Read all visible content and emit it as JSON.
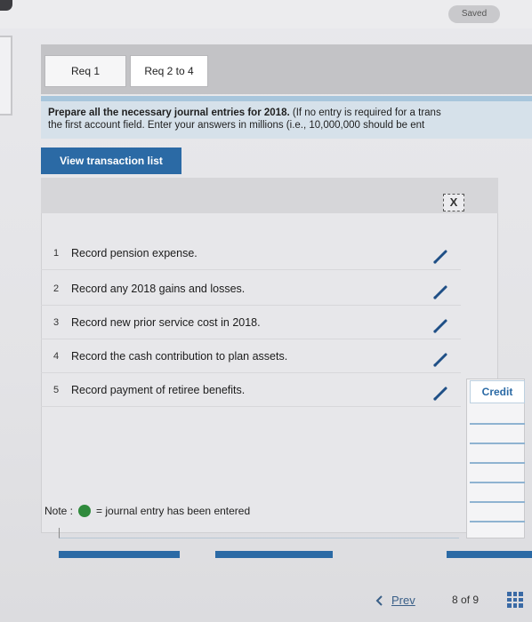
{
  "header": {
    "saved_label": "Saved"
  },
  "tabs": [
    {
      "label": "Req 1"
    },
    {
      "label": "Req 2 to 4"
    }
  ],
  "instruction": {
    "bold_text": "Prepare all the necessary journal entries for 2018.",
    "line1_rest": " (If no entry is required for a trans",
    "line2": "the first account field. Enter your answers in millions (i.e., 10,000,000 should be ent"
  },
  "view_transaction_button": "View transaction list",
  "close_symbol": "X",
  "entries": [
    {
      "num": "1",
      "text": "Record pension expense."
    },
    {
      "num": "2",
      "text": "Record any 2018 gains and losses."
    },
    {
      "num": "3",
      "text": "Record new prior service cost in 2018."
    },
    {
      "num": "4",
      "text": "Record the cash contribution to plan assets."
    },
    {
      "num": "5",
      "text": "Record payment of retiree benefits."
    }
  ],
  "credit_label": "Credit",
  "note": {
    "prefix": "Note :",
    "suffix": "= journal entry has been entered"
  },
  "pagination": {
    "prev_label": "Prev",
    "current": "8",
    "of_label": "of",
    "total": "9"
  },
  "colors": {
    "accent": "#2b6aa5",
    "entered": "#2f8a3c",
    "pencil": "#1f4f86"
  }
}
